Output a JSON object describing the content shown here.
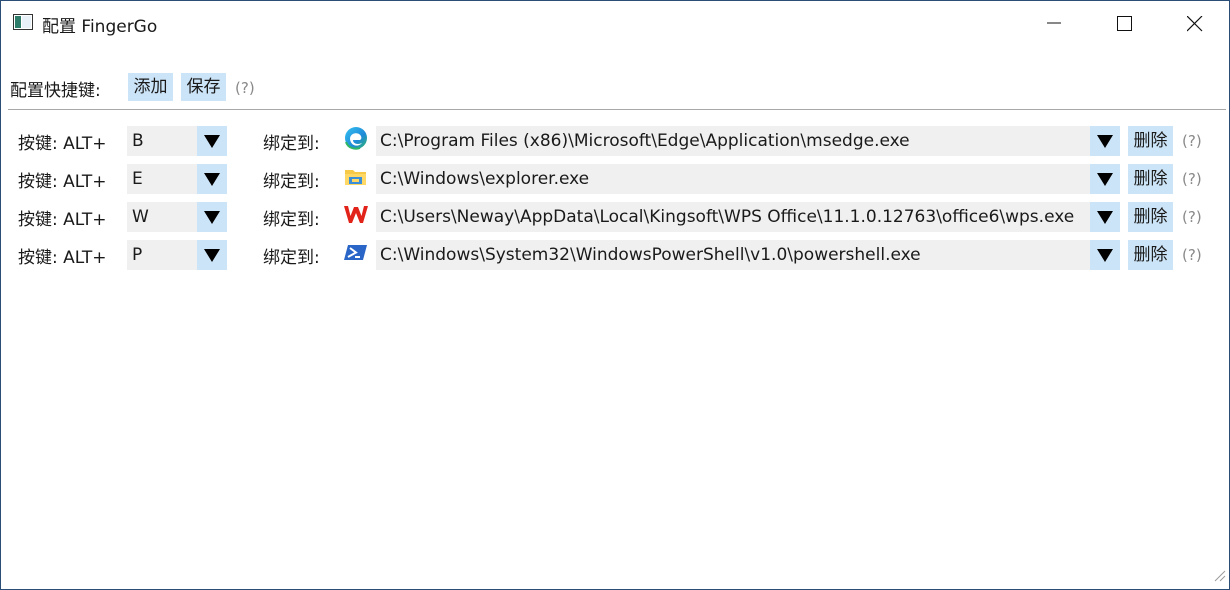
{
  "window": {
    "title": "配置 FingerGo"
  },
  "toolbar": {
    "label": "配置快捷键:",
    "add_label": "添加",
    "save_label": "保存",
    "help_label": "(?)"
  },
  "bindings": [
    {
      "key_label": "按键: ALT+",
      "key": "B",
      "bind_label": "绑定到:",
      "app_icon": "edge-icon",
      "path": "C:\\Program Files (x86)\\Microsoft\\Edge\\Application\\msedge.exe",
      "delete_label": "删除",
      "help_label": "(?)"
    },
    {
      "key_label": "按键: ALT+",
      "key": "E",
      "bind_label": "绑定到:",
      "app_icon": "explorer-folder-icon",
      "path": "C:\\Windows\\explorer.exe",
      "delete_label": "删除",
      "help_label": "(?)"
    },
    {
      "key_label": "按键: ALT+",
      "key": "W",
      "bind_label": "绑定到:",
      "app_icon": "wps-icon",
      "path": "C:\\Users\\Neway\\AppData\\Local\\Kingsoft\\WPS Office\\11.1.0.12763\\office6\\wps.exe",
      "delete_label": "删除",
      "help_label": "(?)"
    },
    {
      "key_label": "按键: ALT+",
      "key": "P",
      "bind_label": "绑定到:",
      "app_icon": "powershell-icon",
      "path": "C:\\Windows\\System32\\WindowsPowerShell\\v1.0\\powershell.exe",
      "delete_label": "删除",
      "help_label": "(?)"
    }
  ],
  "colors": {
    "button_bg": "#cce4f7",
    "field_bg": "#f0f0f0",
    "help_text": "#8a8a8a",
    "window_border": "#2b4e76"
  }
}
